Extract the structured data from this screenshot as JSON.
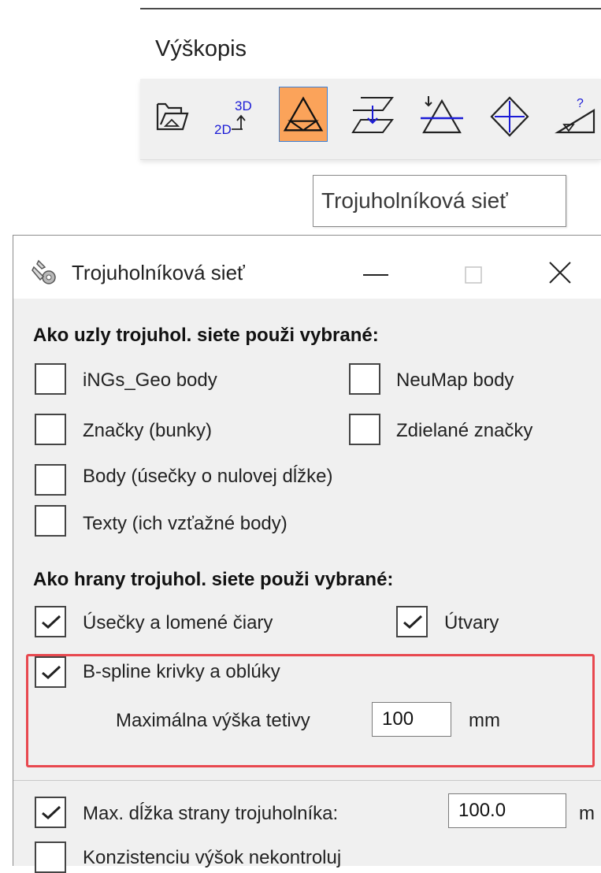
{
  "panel": {
    "title": "Výškopis",
    "toolbar": [
      {
        "icon": "folder-open-icon",
        "label": "Open"
      },
      {
        "icon": "2d-to-3d-icon",
        "label_top": "3D",
        "label_bottom": "2D"
      },
      {
        "icon": "triangle-mesh-icon",
        "active": true
      },
      {
        "icon": "layer-drop-icon"
      },
      {
        "icon": "triangle-insert-point-icon"
      },
      {
        "icon": "diamond-crosshair-icon"
      },
      {
        "icon": "triangle-query-icon",
        "label_q": "?"
      }
    ],
    "tooltip": "Trojuholníková sieť",
    "active_color": "#fba35a"
  },
  "dialog": {
    "title": "Trojuholníková sieť",
    "nodes_heading": "Ako uzly trojuhol. siete použi vybrané:",
    "nodes": {
      "ings_geo": {
        "label": "iNGs_Geo body",
        "checked": false
      },
      "neumap": {
        "label": "NeuMap body",
        "checked": false
      },
      "znacky": {
        "label": "Značky (bunky)",
        "checked": false
      },
      "zdielane": {
        "label": "Zdielané značky",
        "checked": false
      },
      "body": {
        "label": "Body (úsečky o nulovej dĺžke)",
        "checked": false
      },
      "texty": {
        "label": "Texty (ich vzťažné body)",
        "checked": false
      }
    },
    "edges_heading": "Ako hrany trojuhol. siete použi vybrané:",
    "edges": {
      "usecky": {
        "label": "Úsečky a lomené čiary",
        "checked": true
      },
      "utvary": {
        "label": "Útvary",
        "checked": true
      },
      "bspline": {
        "label": "B-spline krivky  a  oblúky",
        "checked": true
      }
    },
    "chord": {
      "label": "Maximálna výška tetivy",
      "value": "100",
      "unit": "mm"
    },
    "max_side": {
      "label": "Max. dĺžka strany trojuholníka:",
      "value": "100.0",
      "unit": "m",
      "checked": true
    },
    "consistency": {
      "label": "Konzistenciu výšok nekontroluj",
      "checked": false
    },
    "highlight_color": "#e8484f"
  }
}
